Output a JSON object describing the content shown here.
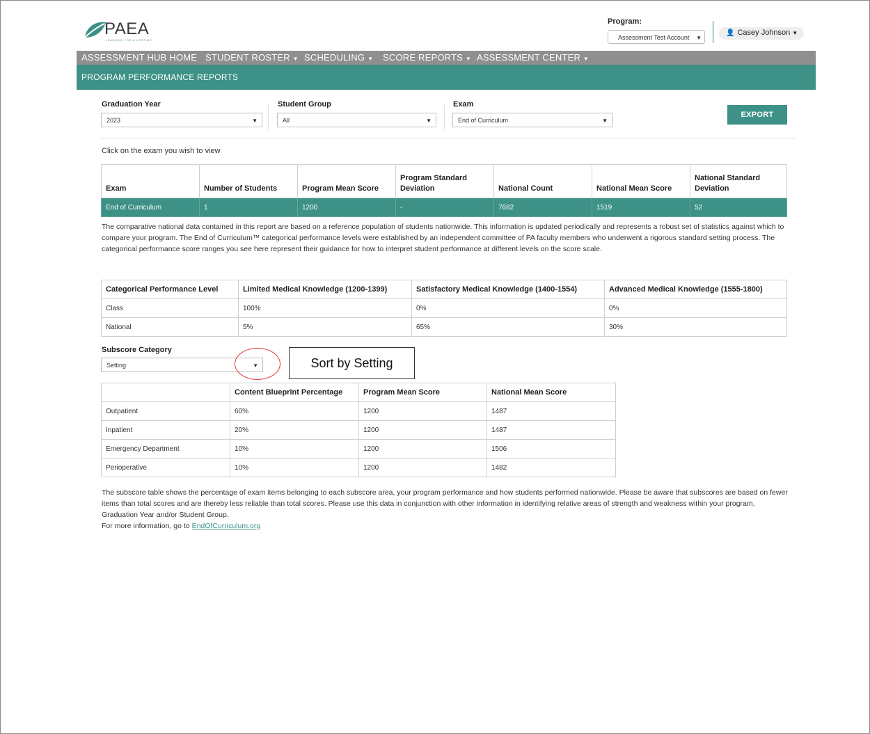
{
  "brand": {
    "name": "PAEA",
    "tagline": "LEARNING FOR A LIFETIME",
    "accent": "#3d9186",
    "nav_gray": "#8f8f8f"
  },
  "header": {
    "program_label": "Program:",
    "program_value": "Assessment Test Account",
    "user_name": "Casey Johnson"
  },
  "nav": {
    "items": [
      "ASSESSMENT HUB HOME",
      "STUDENT ROSTER",
      "SCHEDULING",
      "SCORE REPORTS",
      "ASSESSMENT CENTER"
    ],
    "sub_title": "PROGRAM PERFORMANCE REPORTS"
  },
  "filters": {
    "graduation_year": {
      "label": "Graduation Year",
      "value": "2023"
    },
    "student_group": {
      "label": "Student Group",
      "value": "All"
    },
    "exam": {
      "label": "Exam",
      "value": "End of Curriculum"
    },
    "export_label": "EXPORT"
  },
  "instruction": "Click on the exam you wish to view",
  "exam_table": {
    "headers": [
      "Exam",
      "Number of Students",
      "Program Mean Score",
      "Program Standard Deviation",
      "National Count",
      "National Mean Score",
      "National Standard Deviation"
    ],
    "row": [
      "End of Curriculum",
      "1",
      "1200",
      "-",
      "7682",
      "1519",
      "52"
    ]
  },
  "description": "The comparative national data contained in this report are based on a reference population of students nationwide. This information is updated periodically and represents a robust set of statistics against which to compare your program. The End of Curriculum™ categorical performance levels were established by an independent committee of PA faculty members who underwent a rigorous standard setting process. The categorical performance score ranges you see here represent their guidance for how to interpret student performance at different levels on the score scale.",
  "performance_table": {
    "headers": [
      "Categorical Performance Level",
      "Limited Medical Knowledge (1200-1399)",
      "Satisfactory Medical Knowledge (1400-1554)",
      "Advanced Medical Knowledge (1555-1800)"
    ],
    "rows": [
      [
        "Class",
        "100%",
        "0%",
        "0%"
      ],
      [
        "National",
        "5%",
        "65%",
        "30%"
      ]
    ]
  },
  "subscore": {
    "label": "Subscore Category",
    "value": "Setting",
    "callout": "Sort by Setting"
  },
  "subscore_table": {
    "headers": [
      "",
      "Content Blueprint Percentage",
      "Program Mean Score",
      "National Mean Score"
    ],
    "rows": [
      [
        "Outpatient",
        "60%",
        "1200",
        "1487"
      ],
      [
        "Inpatient",
        "20%",
        "1200",
        "1487"
      ],
      [
        "Emergency Department",
        "10%",
        "1200",
        "1506"
      ],
      [
        "Perioperative",
        "10%",
        "1200",
        "1482"
      ]
    ]
  },
  "footer": {
    "text": "The subscore table shows the percentage of exam items belonging to each subscore area, your program performance and how students performed nationwide. Please be aware that subscores are based on fewer items than total scores and are thereby less reliable than total scores. Please use this data in conjunction with other information in identifying relative areas of strength and weakness within your program, Graduation Year and/or Student Group.",
    "more_prefix": "For more information, go to ",
    "link_text": "EndOfCurriculum.org"
  }
}
